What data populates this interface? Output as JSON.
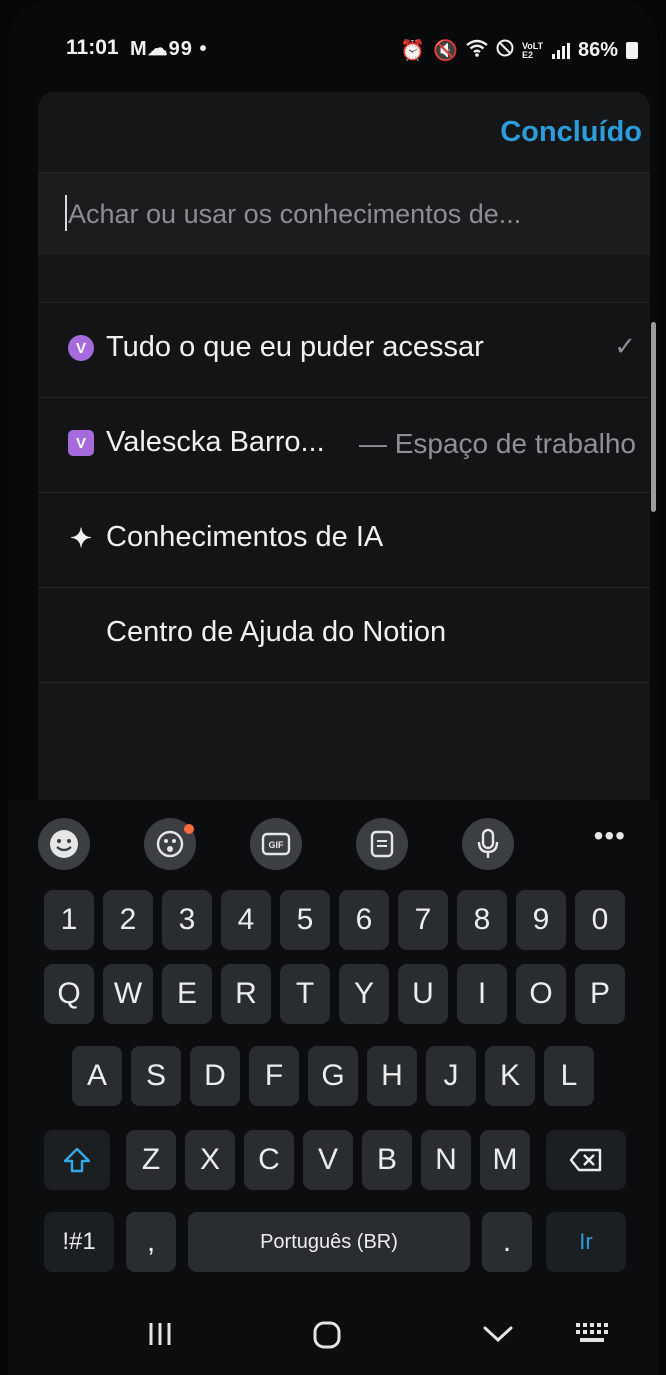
{
  "status": {
    "time": "11:01",
    "left_icons": "M☁99 •",
    "network": "VoLTE2",
    "battery": "86%"
  },
  "sheet": {
    "done_label": "Concluído",
    "search_placeholder": "Achar ou usar os conhecimentos de...",
    "options": [
      {
        "label": "Tudo o que eu puder acessar",
        "icon": "workspace-circle-icon",
        "icon_letter": "V",
        "selected": true
      },
      {
        "label": "Valescka Barro...",
        "subtitle": "— Espaço de trabalho",
        "icon": "workspace-square-icon",
        "icon_letter": "V"
      },
      {
        "label": "Conhecimentos de IA",
        "icon": "sparkle-icon",
        "icon_glyph": "✦"
      },
      {
        "label": "Centro de Ajuda do Notion"
      }
    ]
  },
  "keyboard": {
    "toolbar": [
      "emoji-icon",
      "sticker-icon",
      "gif-icon",
      "clipboard-icon",
      "microphone-icon",
      "more-icon"
    ],
    "row_numbers": [
      "1",
      "2",
      "3",
      "4",
      "5",
      "6",
      "7",
      "8",
      "9",
      "0"
    ],
    "row_q": [
      "Q",
      "W",
      "E",
      "R",
      "T",
      "Y",
      "U",
      "I",
      "O",
      "P"
    ],
    "row_a": [
      "A",
      "S",
      "D",
      "F",
      "G",
      "H",
      "J",
      "K",
      "L"
    ],
    "row_z": [
      "Z",
      "X",
      "C",
      "V",
      "B",
      "N",
      "M"
    ],
    "symbols_label": "!#1",
    "comma_label": ",",
    "space_label": "Português (BR)",
    "period_label": ".",
    "go_label": "Ir"
  },
  "colors": {
    "accent": "#2d9cdb",
    "workspace_icon": "#a56bdc"
  }
}
